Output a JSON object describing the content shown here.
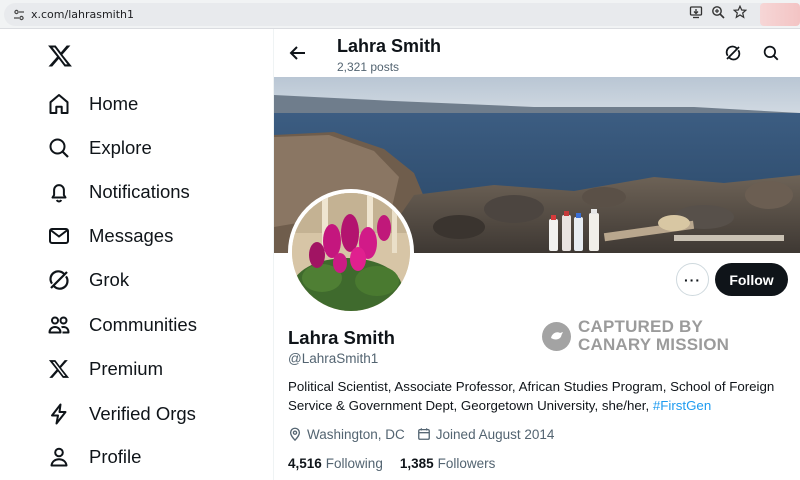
{
  "browser": {
    "url": "x.com/lahrasmith1",
    "icons": [
      "tune-icon",
      "install-icon",
      "zoom-icon",
      "bookmark-star-icon"
    ]
  },
  "sidebar": {
    "logo": "x-logo",
    "items": [
      {
        "label": "Home",
        "icon": "home-icon"
      },
      {
        "label": "Explore",
        "icon": "search-icon"
      },
      {
        "label": "Notifications",
        "icon": "bell-icon"
      },
      {
        "label": "Messages",
        "icon": "mail-icon"
      },
      {
        "label": "Grok",
        "icon": "grok-icon"
      },
      {
        "label": "Communities",
        "icon": "people-icon"
      },
      {
        "label": "Premium",
        "icon": "x-logo-icon"
      },
      {
        "label": "Verified Orgs",
        "icon": "lightning-icon"
      },
      {
        "label": "Profile",
        "icon": "person-icon"
      }
    ]
  },
  "header": {
    "name": "Lahra Smith",
    "posts": "2,321 posts"
  },
  "profile": {
    "name": "Lahra Smith",
    "handle": "@LahraSmith1",
    "bio_text": "Political Scientist, Associate Professor, African Studies Program, School of Foreign Service & Government Dept, Georgetown University, she/her, ",
    "bio_hashtag": "#FirstGen",
    "location": "Washington, DC",
    "joined": "Joined August 2014",
    "following_count": "4,516",
    "following_label": "Following",
    "followers_count": "1,385",
    "followers_label": "Followers",
    "follow_button": "Follow",
    "more_button": "···"
  },
  "watermark": {
    "line1": "CAPTURED BY",
    "line2": "CANARY MISSION"
  },
  "colors": {
    "accent": "#1d9bf0",
    "text": "#0f1419",
    "muted": "#536471",
    "follow_bg": "#0f1419"
  }
}
